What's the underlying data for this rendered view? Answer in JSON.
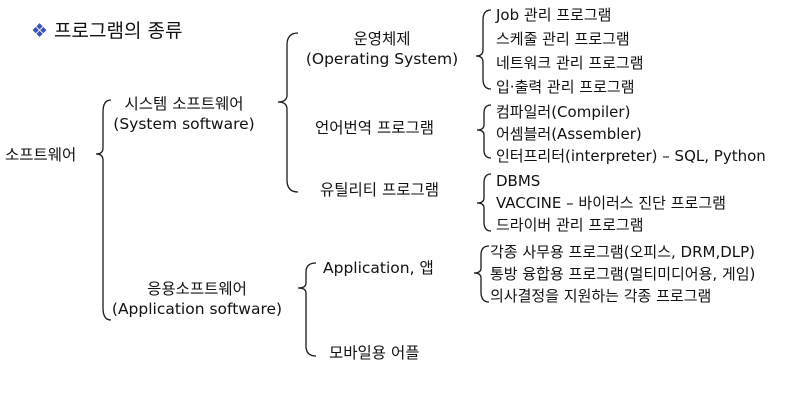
{
  "title": {
    "bullet": "❖",
    "text": "프로그램의 종류"
  },
  "root": "소프트웨어",
  "system": {
    "name": "시스템 소프트웨어",
    "english": "(System software)"
  },
  "application": {
    "name": "응용소프트웨어",
    "english": "(Application software)"
  },
  "os": {
    "name": "운영체제",
    "english": "(Operating System)",
    "items": [
      "Job 관리 프로그램",
      "스케줄 관리 프로그램",
      "네트워크 관리 프로그램",
      "입·출력 관리 프로그램"
    ]
  },
  "lang": {
    "name": "언어번역 프로그램",
    "items": [
      "컴파일러(Compiler)",
      "어셈블러(Assembler)",
      "인터프리터(interpreter) – SQL, Python"
    ]
  },
  "util": {
    "name": "유틸리티 프로그램",
    "items": [
      "DBMS",
      "VACCINE – 바이러스 진단 프로그램",
      "드라이버 관리 프로그램"
    ]
  },
  "app": {
    "name": "Application, 앱",
    "items": [
      "각종 사무용 프로그램(오피스, DRM,DLP)",
      "통방 융합용 프로그램(멀티미디어용, 게임)",
      "의사결정을 지원하는 각종 프로그램"
    ]
  },
  "mobile": {
    "name": "모바일용 어플"
  }
}
